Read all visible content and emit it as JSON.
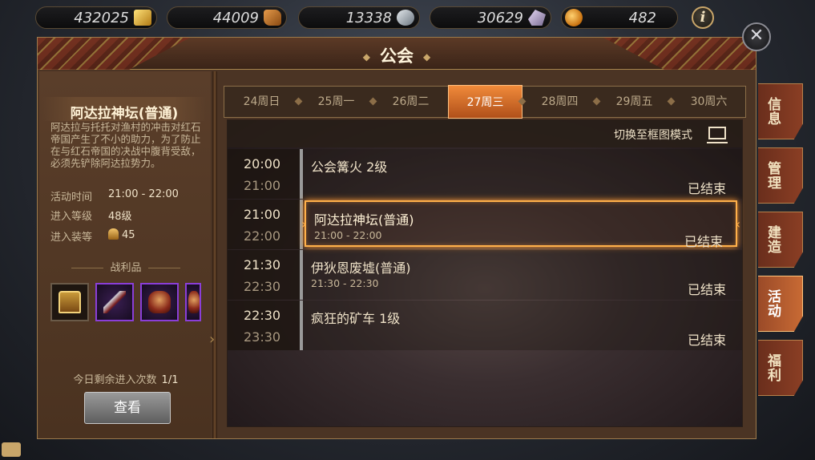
{
  "resources": {
    "gold": "432025",
    "wood": "44009",
    "iron": "13338",
    "crystal": "30629",
    "potion": "482"
  },
  "icons": {
    "gold": "gold-bars-icon",
    "wood": "wood-icon",
    "iron": "iron-ore-icon",
    "crystal": "crystal-ore-icon",
    "potion": "potion-icon",
    "info": "info-icon",
    "close": "close-icon",
    "grid": "grid-view-icon"
  },
  "info_label": "i",
  "close_label": "✕",
  "panel": {
    "title": "公会"
  },
  "dungeon": {
    "name": "阿达拉神坛(普通)",
    "description": "阿达拉与托托对渔村的冲击对红石帝国产生了不小的助力，为了防止在与红石帝国的决战中腹背受敌，必须先铲除阿达拉势力。",
    "time_label": "活动时间",
    "time_value": "21:00 - 22:00",
    "level_label": "进入等级",
    "level_value": "48级",
    "equip_label": "进入装等",
    "equip_value": "45",
    "loot_title": "战利品",
    "loot_items": [
      "treasure-chest-icon",
      "blade-icon",
      "armor-icon",
      "armor-icon"
    ],
    "remain_label": "今日剩余进入次数",
    "remain_value": "1/1",
    "view_button": "查看"
  },
  "tabs": [
    {
      "label": "24周日",
      "active": false
    },
    {
      "label": "25周一",
      "active": false
    },
    {
      "label": "26周二",
      "active": false
    },
    {
      "label": "27周三",
      "active": true
    },
    {
      "label": "28周四",
      "active": false
    },
    {
      "label": "29周五",
      "active": false
    },
    {
      "label": "30周六",
      "active": false
    }
  ],
  "switch_label": "切换至框图模式",
  "schedule": [
    {
      "start": "20:00",
      "end": "21:00",
      "name": "公会篝火 2级",
      "sub": "",
      "status": "已结束",
      "selected": false
    },
    {
      "start": "21:00",
      "end": "22:00",
      "name": "阿达拉神坛(普通)",
      "sub": "21:00 - 22:00",
      "status": "已结束",
      "selected": true
    },
    {
      "start": "21:30",
      "end": "22:30",
      "name": "伊狄恩废墟(普通)",
      "sub": "21:30 - 22:30",
      "status": "已结束",
      "selected": false
    },
    {
      "start": "22:30",
      "end": "23:30",
      "name": "疯狂的矿车 1级",
      "sub": "",
      "status": "已结束",
      "selected": false
    }
  ],
  "side_tabs": [
    {
      "label": "信息",
      "active": false
    },
    {
      "label": "管理",
      "active": false
    },
    {
      "label": "建造",
      "active": false
    },
    {
      "label": "活动",
      "active": true
    },
    {
      "label": "福利",
      "active": false
    }
  ]
}
